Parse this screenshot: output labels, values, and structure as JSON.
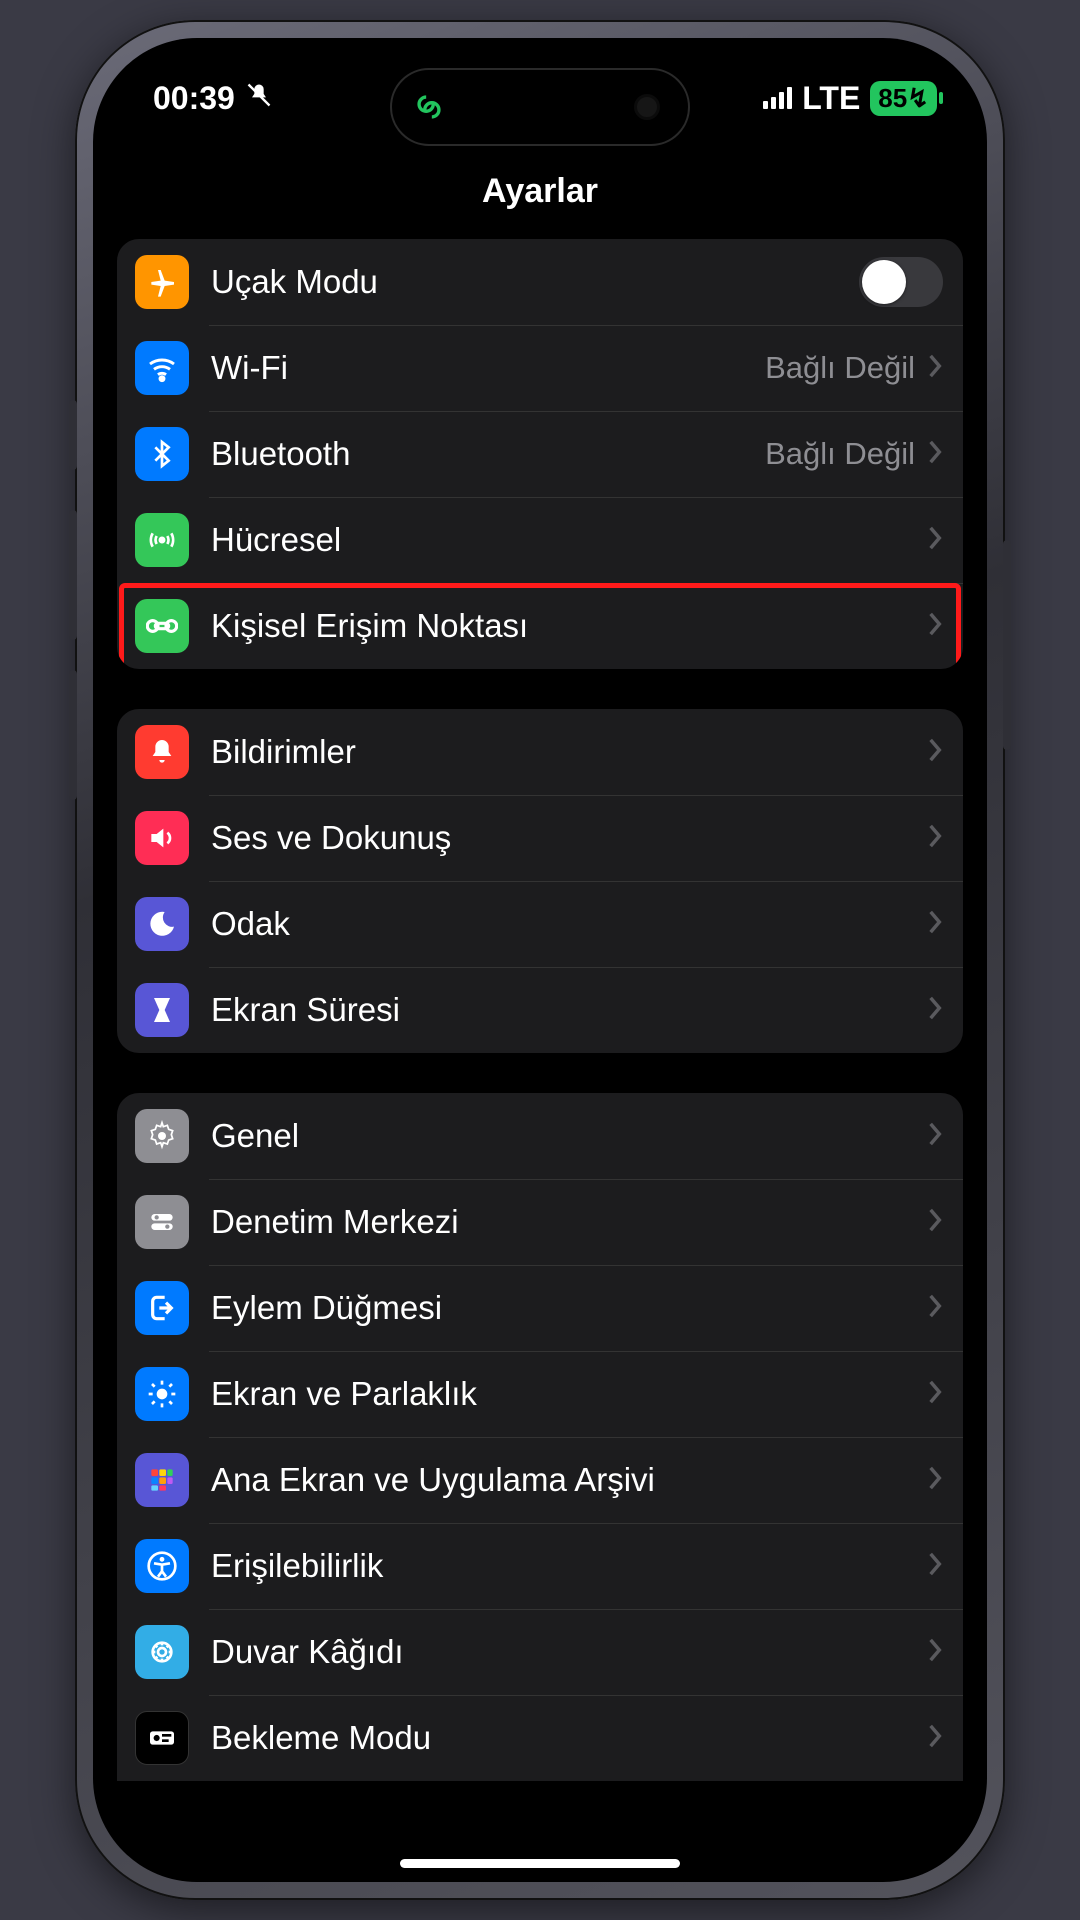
{
  "status": {
    "time": "00:39",
    "network": "LTE",
    "battery": "85"
  },
  "title": "Ayarlar",
  "rows": {
    "airplane": {
      "label": "Uçak Modu"
    },
    "wifi": {
      "label": "Wi-Fi",
      "detail": "Bağlı Değil"
    },
    "bluetooth": {
      "label": "Bluetooth",
      "detail": "Bağlı Değil"
    },
    "cellular": {
      "label": "Hücresel"
    },
    "hotspot": {
      "label": "Kişisel Erişim Noktası"
    },
    "notifications": {
      "label": "Bildirimler"
    },
    "sounds": {
      "label": "Ses ve Dokunuş"
    },
    "focus": {
      "label": "Odak"
    },
    "screentime": {
      "label": "Ekran Süresi"
    },
    "general": {
      "label": "Genel"
    },
    "control": {
      "label": "Denetim Merkezi"
    },
    "actionbtn": {
      "label": "Eylem Düğmesi"
    },
    "display": {
      "label": "Ekran ve Parlaklık"
    },
    "homescreen": {
      "label": "Ana Ekran ve Uygulama Arşivi"
    },
    "accessibility": {
      "label": "Erişilebilirlik"
    },
    "wallpaper": {
      "label": "Duvar Kâğıdı"
    },
    "standby": {
      "label": "Bekleme Modu"
    }
  }
}
